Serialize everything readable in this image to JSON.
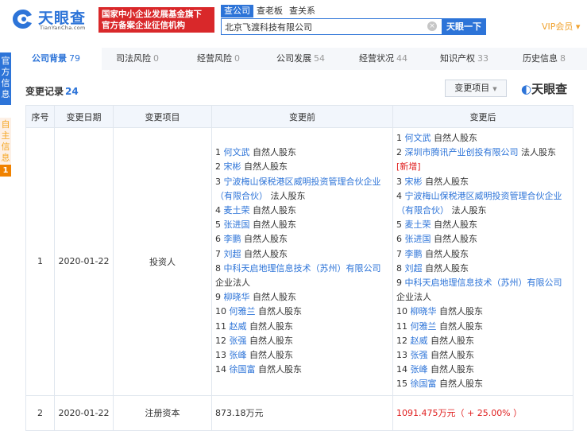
{
  "header": {
    "logo_text": "天眼查",
    "logo_sub": "TianYanCha.com",
    "badge_line1": "国家中小企业发展基金旗下",
    "badge_line2": "官方备案企业征信机构",
    "search_tabs": [
      "查公司",
      "查老板",
      "查关系"
    ],
    "search_value": "北京飞渡科技有限公司",
    "search_button": "天眼一下",
    "clear_icon": "×",
    "vip_label": "VIP会员 ▾"
  },
  "side": {
    "official": "官方信息",
    "self": "自主信息",
    "self_count": "1"
  },
  "nav": [
    {
      "label": "公司背景",
      "count": "79",
      "active": true
    },
    {
      "label": "司法风险",
      "count": "0"
    },
    {
      "label": "经营风险",
      "count": "0"
    },
    {
      "label": "公司发展",
      "count": "54"
    },
    {
      "label": "经营状况",
      "count": "44"
    },
    {
      "label": "知识产权",
      "count": "33"
    },
    {
      "label": "历史信息",
      "count": "8"
    }
  ],
  "section": {
    "title": "变更记录",
    "count": "24",
    "filter_label": "变更项目",
    "brand_text": "天眼查"
  },
  "table": {
    "headers": [
      "序号",
      "变更日期",
      "变更项目",
      "变更前",
      "变更后"
    ],
    "rows": [
      {
        "index": "1",
        "date": "2020-01-22",
        "item": "投资人",
        "before": [
          {
            "n": "1",
            "name": "何文武",
            "role": "自然人股东"
          },
          {
            "n": "2",
            "name": "宋彬",
            "role": "自然人股东"
          },
          {
            "n": "3",
            "name": "宁波梅山保税港区威明投资管理合伙企业（有限合伙）",
            "role": "法人股东"
          },
          {
            "n": "4",
            "name": "麦土荣",
            "role": "自然人股东"
          },
          {
            "n": "5",
            "name": "张进国",
            "role": "自然人股东"
          },
          {
            "n": "6",
            "name": "李鹏",
            "role": "自然人股东"
          },
          {
            "n": "7",
            "name": "刘超",
            "role": "自然人股东"
          },
          {
            "n": "8",
            "name": "中科天启地理信息技术（苏州）有限公司",
            "role": "企业法人"
          },
          {
            "n": "9",
            "name": "柳晓华",
            "role": "自然人股东"
          },
          {
            "n": "10",
            "name": "何雅兰",
            "role": "自然人股东"
          },
          {
            "n": "11",
            "name": "赵威",
            "role": "自然人股东"
          },
          {
            "n": "12",
            "name": "张强",
            "role": "自然人股东"
          },
          {
            "n": "13",
            "name": "张峰",
            "role": "自然人股东"
          },
          {
            "n": "14",
            "name": "徐国富",
            "role": "自然人股东"
          }
        ],
        "after": [
          {
            "n": "1",
            "name": "何文武",
            "role": "自然人股东"
          },
          {
            "n": "2",
            "name": "深圳市腾讯产业创投有限公司",
            "role": "法人股东",
            "tag": "[新增]"
          },
          {
            "n": "3",
            "name": "宋彬",
            "role": "自然人股东"
          },
          {
            "n": "4",
            "name": "宁波梅山保税港区威明投资管理合伙企业（有限合伙）",
            "role": "法人股东"
          },
          {
            "n": "5",
            "name": "麦土荣",
            "role": "自然人股东"
          },
          {
            "n": "6",
            "name": "张进国",
            "role": "自然人股东"
          },
          {
            "n": "7",
            "name": "李鹏",
            "role": "自然人股东"
          },
          {
            "n": "8",
            "name": "刘超",
            "role": "自然人股东"
          },
          {
            "n": "9",
            "name": "中科天启地理信息技术（苏州）有限公司",
            "role": "企业法人"
          },
          {
            "n": "10",
            "name": "柳晓华",
            "role": "自然人股东"
          },
          {
            "n": "11",
            "name": "何雅兰",
            "role": "自然人股东"
          },
          {
            "n": "12",
            "name": "赵威",
            "role": "自然人股东"
          },
          {
            "n": "13",
            "name": "张强",
            "role": "自然人股东"
          },
          {
            "n": "14",
            "name": "张峰",
            "role": "自然人股东"
          },
          {
            "n": "15",
            "name": "徐国富",
            "role": "自然人股东"
          }
        ]
      },
      {
        "index": "2",
        "date": "2020-01-22",
        "item": "注册资本",
        "before_text": "873.18万元",
        "after_text": "1091.475万元（ + 25.00% ）"
      }
    ]
  },
  "colors": {
    "brand_blue": "#2d74d8",
    "badge_red": "#d9282a",
    "vip_gold": "#f0a22e",
    "side_orange": "#f08200"
  }
}
